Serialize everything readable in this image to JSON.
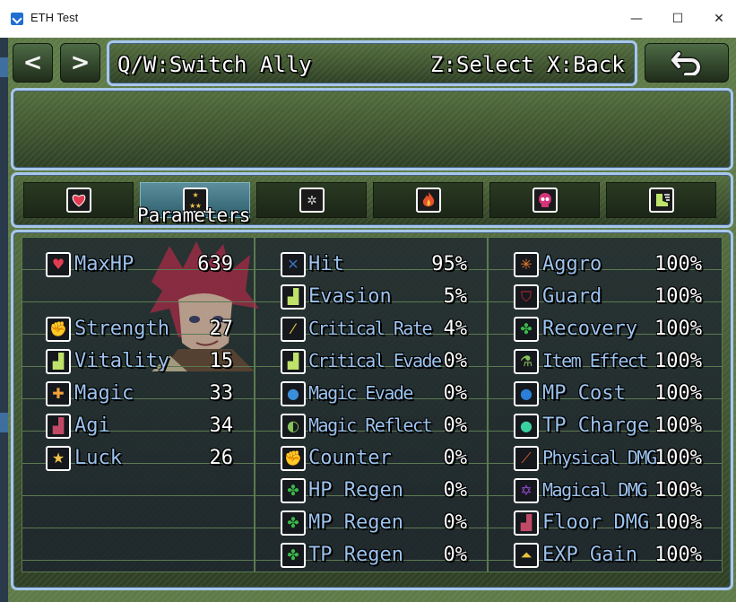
{
  "window": {
    "title": "ETH Test",
    "minimize": "—",
    "maximize": "☐",
    "close": "✕"
  },
  "nav": {
    "prev": "<",
    "next": ">",
    "back_icon": "back-arrow-icon"
  },
  "help": {
    "switch": "Q/W:Switch Ally",
    "select": "Z:Select X:Back"
  },
  "tabs": [
    {
      "icon": "heart-icon",
      "color": "#e23b52"
    },
    {
      "icon": "stars-icon",
      "color": "#f0c24a",
      "label": "Parameters",
      "active": true
    },
    {
      "icon": "gear-icon",
      "color": "#cfcfcf"
    },
    {
      "icon": "flame-icon",
      "color": "#e6502a"
    },
    {
      "icon": "skull-icon",
      "color": "#d6337a"
    },
    {
      "icon": "running-boot-icon",
      "color": "#bfe36a"
    }
  ],
  "stats": {
    "basic": [
      {
        "label": "MaxHP",
        "value": "639",
        "icon": "heart-icon",
        "color": "#e23b52"
      },
      {
        "label": "Strength",
        "value": "27",
        "icon": "fist-icon",
        "color": "#3a8fd8"
      },
      {
        "label": "Vitality",
        "value": "15",
        "icon": "boot-icon",
        "color": "#bfe36a"
      },
      {
        "label": "Magic",
        "value": "33",
        "icon": "holy-cross-icon",
        "color": "#f2a03a"
      },
      {
        "label": "Agi",
        "value": "34",
        "icon": "boot-icon",
        "color": "#c04a66"
      },
      {
        "label": "Luck",
        "value": "26",
        "icon": "stars-icon",
        "color": "#f0c24a"
      }
    ],
    "extra": [
      {
        "label": "Hit",
        "value": "95%",
        "icon": "crossed-swords-icon",
        "color": "#3a6fb8"
      },
      {
        "label": "Evasion",
        "value": "5%",
        "icon": "boot-icon",
        "color": "#bfe36a"
      },
      {
        "label": "Critical Rate",
        "value": "4%",
        "icon": "slash-icon",
        "color": "#f2c24a"
      },
      {
        "label": "Critical Evade",
        "value": "0%",
        "icon": "boot-icon",
        "color": "#bfe36a"
      },
      {
        "label": "Magic Evade",
        "value": "0%",
        "icon": "water-drop-icon",
        "color": "#3a8fd8"
      },
      {
        "label": "Magic Reflect",
        "value": "0%",
        "icon": "reflect-icon",
        "color": "#86c45a"
      },
      {
        "label": "Counter",
        "value": "0%",
        "icon": "fist-icon",
        "color": "#3a8fd8"
      },
      {
        "label": "HP Regen",
        "value": "0%",
        "icon": "clover-icon",
        "color": "#3ab84a"
      },
      {
        "label": "MP Regen",
        "value": "0%",
        "icon": "clover-icon",
        "color": "#3ab84a"
      },
      {
        "label": "TP Regen",
        "value": "0%",
        "icon": "clover-icon",
        "color": "#3ab84a"
      }
    ],
    "special": [
      {
        "label": "Aggro",
        "value": "100%",
        "icon": "aggro-icon",
        "color": "#e87a2a"
      },
      {
        "label": "Guard",
        "value": "100%",
        "icon": "shield-icon",
        "color": "#c0283c"
      },
      {
        "label": "Recovery",
        "value": "100%",
        "icon": "clover-icon",
        "color": "#3ab84a"
      },
      {
        "label": "Item Effect",
        "value": "100%",
        "icon": "potion-icon",
        "color": "#86c45a"
      },
      {
        "label": "MP Cost",
        "value": "100%",
        "icon": "blue-orb-icon",
        "color": "#2a7fd8"
      },
      {
        "label": "TP Charge",
        "value": "100%",
        "icon": "green-orb-icon",
        "color": "#3ad0a0"
      },
      {
        "label": "Physical DMG",
        "value": "100%",
        "icon": "sword-slash-icon",
        "color": "#e8602a"
      },
      {
        "label": "Magical DMG",
        "value": "100%",
        "icon": "hexagram-icon",
        "color": "#9a4ad8"
      },
      {
        "label": "Floor DMG",
        "value": "100%",
        "icon": "boot-icon",
        "color": "#c04a66"
      },
      {
        "label": "EXP Gain",
        "value": "100%",
        "icon": "level-up-icon",
        "color": "#e8c23a"
      }
    ]
  }
}
